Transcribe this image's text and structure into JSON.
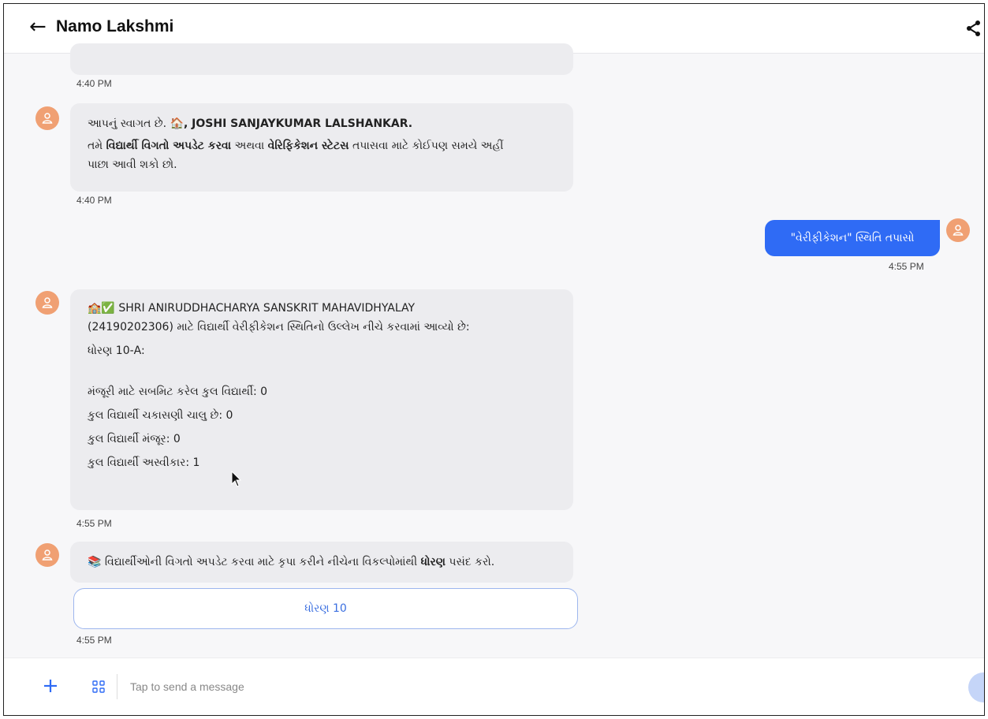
{
  "header": {
    "back_icon": "arrow-left-icon",
    "title": "Namo Lakshmi",
    "share_icon": "share-icon"
  },
  "messages": {
    "top_partial": {
      "time": "4:40 PM"
    },
    "welcome": {
      "prefix": "આપનું સ્વાગત છે. ",
      "emoji": "🏠",
      "name": ", JOSHI SANJAYKUMAR LALSHANKAR.",
      "line2_a": "તમે ",
      "line2_b": "વિદ્યાર્થી વિગતો અપડેટ કરવા",
      "line2_c": " અથવા ",
      "line2_d": "વેરિફિકેશન સ્ટેટસ",
      "line2_e": " તપાસવા માટે કોઈપણ સમયે અહીં",
      "line3": "પાછા આવી શકો છો.",
      "time": "4:40 PM"
    },
    "user": {
      "text": "\"વેરીફીકેશન\" સ્થિતિ તપાસો",
      "time": "4:55 PM"
    },
    "status": {
      "emoji": "🏫✅",
      "line1": " SHRI ANIRUDDHACHARYA SANSKRIT MAHAVIDHYALAY",
      "line2": "(24190202306) માટે વિદ્યાર્થી વેરીફીકેશન સ્થિતિનો ઉલ્લેખ નીચે કરવામાં આવ્યો છે:",
      "line3": "ધોરણ 10-A:",
      "stat1": "મંજૂરી માટે સબમિટ કરેલ કુલ વિદ્યાર્થી: 0",
      "stat2": "કુલ વિદ્યાર્થી ચકાસણી ચાલુ છે: 0",
      "stat3": "કુલ વિદ્યાર્થી મંજૂર: 0",
      "stat4": "કુલ વિદ્યાર્થી અસ્વીકાર: 1",
      "time": "4:55 PM"
    },
    "select": {
      "emoji": "📚",
      "text_a": " વિદ્યાર્થીઓની વિગતો અપડેટ કરવા માટે કૃપા કરીને નીચેના વિકલ્પોમાંથી ",
      "text_b": "ધોરણ",
      "text_c": " પસંદ કરો.",
      "option": "ધોરણ 10",
      "time": "4:55 PM"
    }
  },
  "input_bar": {
    "placeholder": "Tap to send a message",
    "plus_icon": "plus-icon",
    "menu_icon": "grid-menu-icon",
    "send_icon": "send-icon"
  },
  "colors": {
    "accent": "#2f6bf5",
    "avatar": "#f0a073",
    "bubble": "#ececef"
  }
}
